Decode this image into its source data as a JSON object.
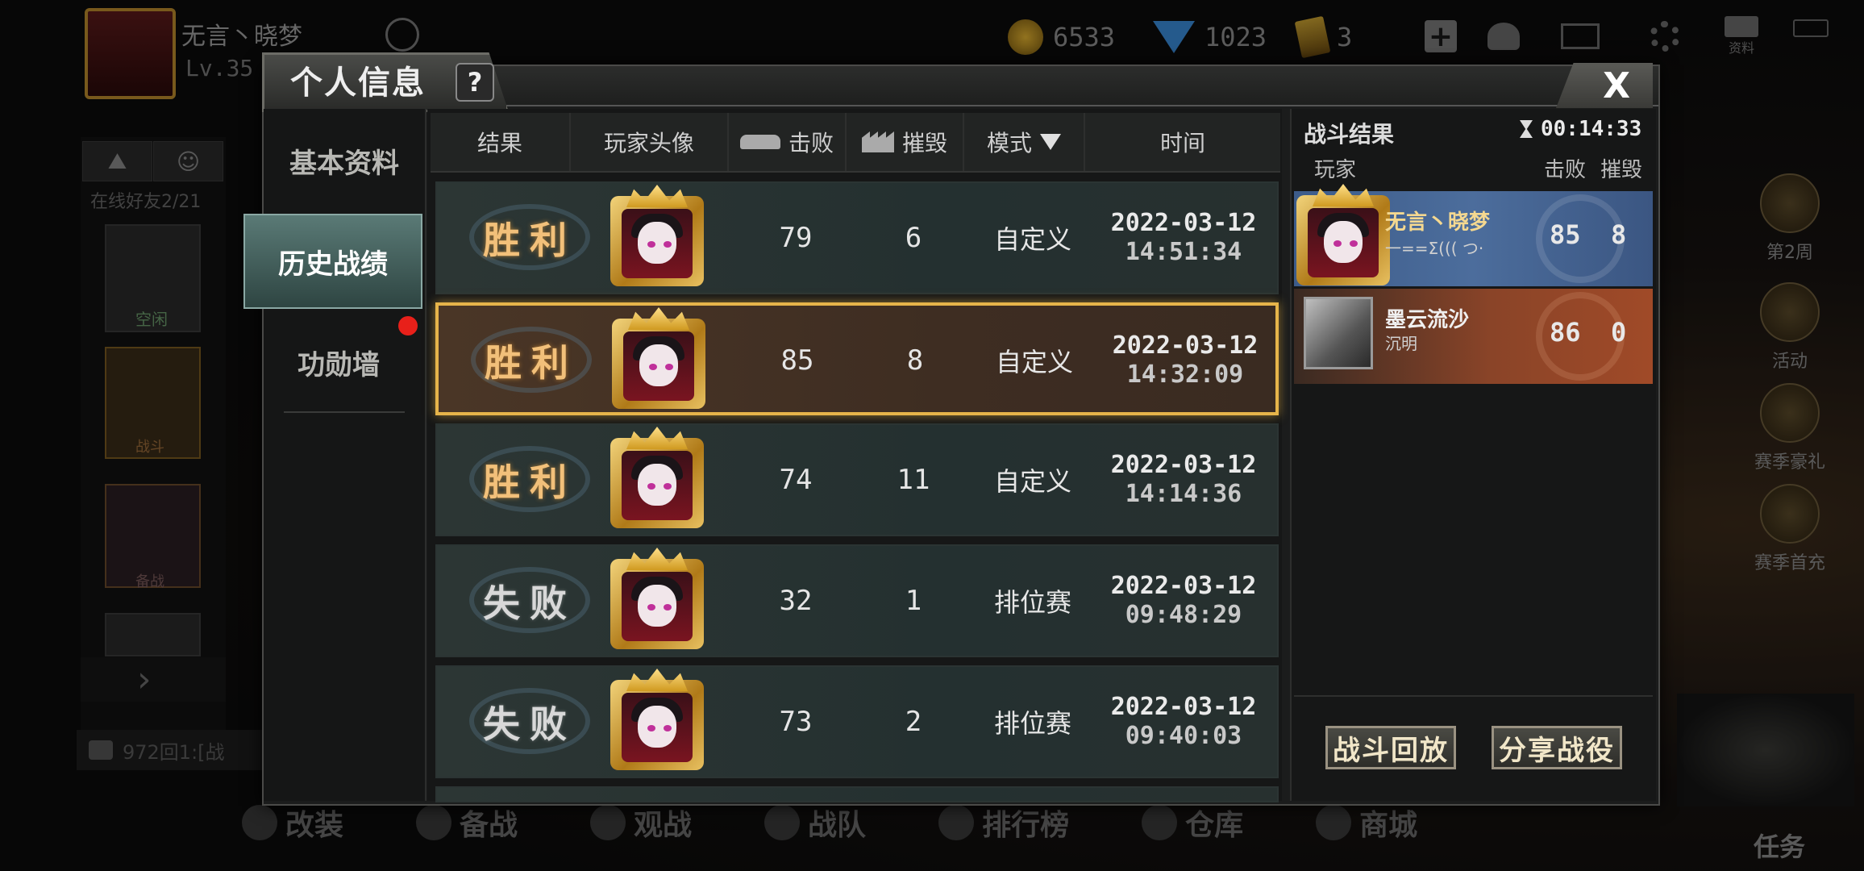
{
  "background": {
    "player_name": "无言丶晓梦",
    "player_level": "Lv.35",
    "currency": [
      {
        "icon": "gold-coin-icon",
        "value": "6533"
      },
      {
        "icon": "diamond-icon",
        "value": "1023"
      },
      {
        "icon": "card-icon",
        "value": "3"
      }
    ],
    "top_icons": [
      "plus-icon",
      "friends-icon",
      "mail-icon",
      "settings-icon",
      "profile-book-icon",
      "battery-icon"
    ],
    "profile_book_label": "资料",
    "online_friends": "在线好友2/21",
    "friend_status": "空闲",
    "friend2_tag": "战斗",
    "friend3_tag": "备战",
    "chat_preview": "972回1:[战",
    "right_menu": [
      "第2周",
      "活动",
      "赛季豪礼",
      "赛季首充"
    ],
    "task_label": "任务",
    "bottom_nav": [
      "改装",
      "备战",
      "观战",
      "战队",
      "排行榜",
      "仓库",
      "商城"
    ]
  },
  "dialog": {
    "title": "个人信息",
    "help_label": "?",
    "close_label": "X",
    "nav": [
      {
        "label": "基本资料"
      },
      {
        "label": "历史战绩",
        "active": true
      },
      {
        "label": "功勋墙",
        "badge": true
      }
    ],
    "table": {
      "headers": {
        "result": "结果",
        "avatar": "玩家头像",
        "kills": "击败",
        "destroys": "摧毁",
        "mode": "模式",
        "time": "时间"
      },
      "rows": [
        {
          "result": "胜利",
          "outcome": "win",
          "kills": "79",
          "destroys": "6",
          "mode": "自定义",
          "date": "2022-03-12",
          "time": "14:51:34"
        },
        {
          "result": "胜利",
          "outcome": "win",
          "kills": "85",
          "destroys": "8",
          "mode": "自定义",
          "date": "2022-03-12",
          "time": "14:32:09",
          "selected": true
        },
        {
          "result": "胜利",
          "outcome": "win",
          "kills": "74",
          "destroys": "11",
          "mode": "自定义",
          "date": "2022-03-12",
          "time": "14:14:36"
        },
        {
          "result": "失败",
          "outcome": "lose",
          "kills": "32",
          "destroys": "1",
          "mode": "排位赛",
          "date": "2022-03-12",
          "time": "09:48:29"
        },
        {
          "result": "失败",
          "outcome": "lose",
          "kills": "73",
          "destroys": "2",
          "mode": "排位赛",
          "date": "2022-03-12",
          "time": "09:40:03"
        }
      ]
    },
    "battle_result": {
      "title": "战斗结果",
      "timer": "00:14:33",
      "col_player": "玩家",
      "col_kills": "击败",
      "col_destroys": "摧毁",
      "players": [
        {
          "name": "无言丶晓梦",
          "sub": "一==Σ((( つ·",
          "kills": "85",
          "destroys": "8",
          "team": "blue"
        },
        {
          "name": "墨云流沙",
          "sub": "沉明",
          "kills": "86",
          "destroys": "0",
          "team": "red"
        }
      ],
      "replay_label": "战斗回放",
      "share_label": "分享战役"
    }
  }
}
